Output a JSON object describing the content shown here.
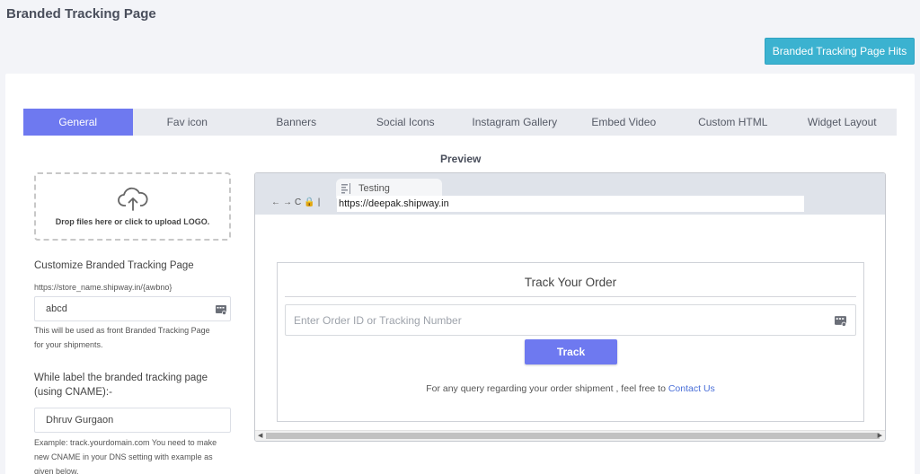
{
  "header": {
    "title": "Branded Tracking Page",
    "hits_button": "Branded Tracking Page Hits"
  },
  "tabs": [
    {
      "label": "General",
      "active": true
    },
    {
      "label": "Fav icon"
    },
    {
      "label": "Banners"
    },
    {
      "label": "Social Icons"
    },
    {
      "label": "Instagram Gallery"
    },
    {
      "label": "Embed Video"
    },
    {
      "label": "Custom HTML"
    },
    {
      "label": "Widget Layout"
    }
  ],
  "left": {
    "dropzone_text": "Drop files here or click to upload LOGO.",
    "customize_label": "Customize Branded Tracking Page",
    "customize_url_hint": "https://store_name.shipway.in/{awbno}",
    "customize_value": "abcd",
    "customize_help_1": "This will be used as front Branded Tracking Page",
    "customize_help_2": "for your shipments.",
    "cname_label_1": "While label the branded tracking page",
    "cname_label_2": "(using CNAME):-",
    "cname_value": "Dhruv Gurgaon",
    "cname_help_1": "Example: track.yourdomain.com You need to make",
    "cname_help_2": "new CNAME in your DNS setting with example as",
    "cname_help_3": "given below."
  },
  "preview": {
    "title": "Preview",
    "browser_tab": "Testing",
    "url": "https://deepak.shipway.in",
    "track_title": "Track Your Order",
    "track_placeholder": "Enter Order ID or Tracking Number",
    "track_button": "Track",
    "query_text": "For any query regarding your order shipment , feel free to ",
    "contact_link": "Contact Us"
  },
  "colors": {
    "accent": "#6e79f0",
    "hits_button": "#3bb2d0",
    "link": "#4a6fd8"
  }
}
